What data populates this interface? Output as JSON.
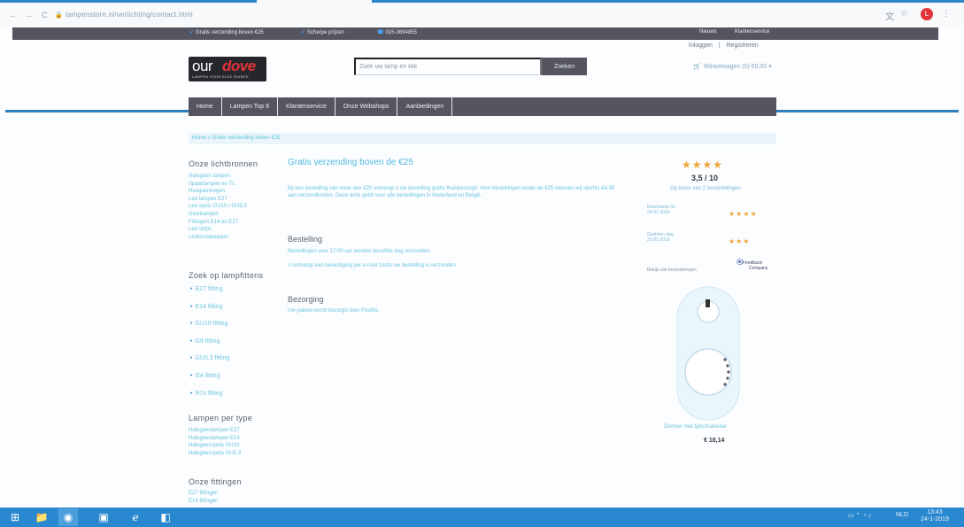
{
  "browser": {
    "url": "lampenstore.nl/verlichting/contact.html",
    "back": "←",
    "forward": "→",
    "reload": "C",
    "profile_initial": "L"
  },
  "infobar": {
    "item1": "Gratis verzending boven €25",
    "item2": "Scherpe prijzen",
    "item3": "015-3694855",
    "right1": "Nieuws",
    "right2": "Klantenservice"
  },
  "account": {
    "login": "Inloggen",
    "sep": "|",
    "register": "Registreren"
  },
  "logo": {
    "word1": "our",
    "word2": "dove",
    "tagline": "LAMPEN VOOR ELKE RUIMTE"
  },
  "search": {
    "placeholder": "Zoek uw lamp en klik",
    "button": "Zoeken"
  },
  "cart": {
    "label": "Winkelwagen (0) €0,00 ▾"
  },
  "menu": [
    "Home",
    "Lampen Top 9",
    "Klantenservice",
    "Onze Webshops",
    "Aanbiedingen"
  ],
  "breadcrumb": "Home » Gratis verzending boven €25",
  "sidebar": {
    "h1": "Onze lichtbronnen",
    "list1": [
      "Halogeen lampen",
      "Spaarlampen en TL",
      "Hoogvermogen",
      "Led lampen E27",
      "Led spots GU10 / GU5.3",
      "Gloeilampen",
      "Fittingen E14 en E27",
      "Led strips",
      "Lichtschakelaars"
    ],
    "h2": "Zoek op lampfittens",
    "list2": [
      "E27 fitting",
      "E14 fitting",
      "GU10 fitting",
      "G9 fitting",
      "GU5.3 fitting",
      "G4 fitting",
      "R7s fitting"
    ],
    "h3": "Lampen per type",
    "list3": [
      "Halogeenlampen E27",
      "Halogeenlampen E14",
      "Halogeenspots GU10",
      "Halogeenspots GU5.3"
    ],
    "h4": "Onze fittingen",
    "list4": [
      "E27 fittingen",
      "E14 fittingen"
    ]
  },
  "main": {
    "title": "Gratis verzending boven de €25",
    "text": "Bij een bestelling van meer dan €25 ontvangt u uw bestelling gratis thuisbezorgd. Voor bestellingen onder de €25 rekenen wij slechts €4,95 aan verzendkosten. Deze actie geldt voor alle bestellingen in Nederland en België.",
    "h2": "Bestelling",
    "line2a": "Bestellingen voor 17:00 uur worden dezelfde dag verzonden.",
    "line2b": "U ontvangt een bevestiging per e-mail zodra uw bestelling is verzonden.",
    "h3": "Bezorging",
    "line3": "Uw pakket wordt bezorgd door PostNL."
  },
  "rating": {
    "stars": "★★★★",
    "score": "3,5 / 10",
    "count": "Op basis van 2 beoordelingen",
    "review1_name": "Buitenlamp XL",
    "review1_date": "24-01-2019",
    "review1_stars": "★★★★",
    "review2_name": "Gesloten dag",
    "review2_date": "23-01-2019",
    "review2_stars": "★★★",
    "read_more": "Bekijk alle beoordelingen",
    "fc_brand": "Feedback",
    "fc_sub": "Company"
  },
  "product": {
    "name": "Dimmer met tijdschakelaar",
    "price": "€ 18,14"
  },
  "tray": {
    "lang": "NLD",
    "time": "13:43",
    "date": "24-1-2019"
  },
  "colors": {
    "accent": "#2c86c7",
    "dark_bar": "#54555f",
    "link": "#6ec5e1",
    "star": "#f0a43a"
  }
}
